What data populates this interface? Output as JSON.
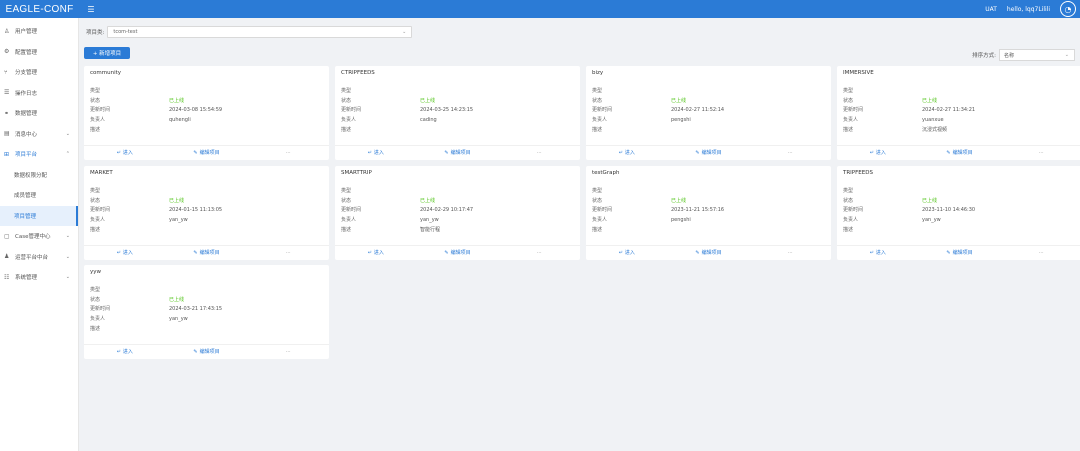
{
  "header": {
    "app_name": "EAGLE-CONF",
    "env": "UAT",
    "greeting": "hello, lqq7Lilili",
    "menu_icon": "hamburger-icon",
    "avatar_icon": "avatar-icon"
  },
  "sidebar": {
    "items": [
      {
        "icon": "user-icon",
        "label": "用户管理"
      },
      {
        "icon": "gear-icon",
        "label": "配置管理"
      },
      {
        "icon": "branch-icon",
        "label": "分支管理"
      },
      {
        "icon": "list-icon",
        "label": "操作日志"
      },
      {
        "icon": "data-icon",
        "label": "数据管理"
      },
      {
        "icon": "message-icon",
        "label": "消息中心"
      },
      {
        "icon": "project-icon",
        "label": "项目平台"
      }
    ],
    "sub_items": [
      {
        "label": "数据权限分配"
      },
      {
        "label": "成员管理"
      },
      {
        "label": "项目管理"
      }
    ],
    "bottom_items": [
      {
        "icon": "case-icon",
        "label": "Case管理中心"
      },
      {
        "icon": "people-icon",
        "label": "运营平台中台"
      },
      {
        "icon": "settings-icon",
        "label": "系统管理"
      }
    ]
  },
  "filter": {
    "label": "项目类:",
    "value": "tcom-test"
  },
  "new_button": "+ 新增项目",
  "sort": {
    "label": "排序方式:",
    "value": "名称"
  },
  "field_labels": {
    "type": "类型",
    "status": "状态",
    "updated": "更新时间",
    "owner": "负责人",
    "desc": "描述"
  },
  "actions": {
    "enter": "进入",
    "edit": "编辑项目",
    "more": "···"
  },
  "cards": [
    {
      "title": "community",
      "type": "",
      "status": "已上线",
      "updated": "2024-03-08 15:54:59",
      "owner": "quhengli",
      "desc": ""
    },
    {
      "title": "CTRIPFEEDS",
      "type": "",
      "status": "已上线",
      "updated": "2024-03-25 14:23:15",
      "owner": "cading",
      "desc": ""
    },
    {
      "title": "bizy",
      "type": "",
      "status": "已上线",
      "updated": "2024-02-27 11:52:14",
      "owner": "pengshi",
      "desc": ""
    },
    {
      "title": "IMMERSIVE",
      "type": "",
      "status": "已上线",
      "updated": "2024-02-27 11:34:21",
      "owner": "yuanxue",
      "desc": "沉浸式视频"
    },
    {
      "title": "MARKET",
      "type": "",
      "status": "已上线",
      "updated": "2024-01-15 11:13:05",
      "owner": "yan_yw",
      "desc": ""
    },
    {
      "title": "SMARTTRIP",
      "type": "",
      "status": "已上线",
      "updated": "2024-02-29 10:17:47",
      "owner": "yan_yw",
      "desc": "智能行程"
    },
    {
      "title": "testGraph",
      "type": "",
      "status": "已上线",
      "updated": "2023-11-21 15:57:16",
      "owner": "pengshi",
      "desc": ""
    },
    {
      "title": "TRIPFEEDS",
      "type": "",
      "status": "已上线",
      "updated": "2023-11-10 14:46:30",
      "owner": "yan_yw",
      "desc": ""
    },
    {
      "title": "yyw",
      "type": "",
      "status": "已上线",
      "updated": "2024-03-21 17:43:15",
      "owner": "yan_yw",
      "desc": ""
    }
  ]
}
